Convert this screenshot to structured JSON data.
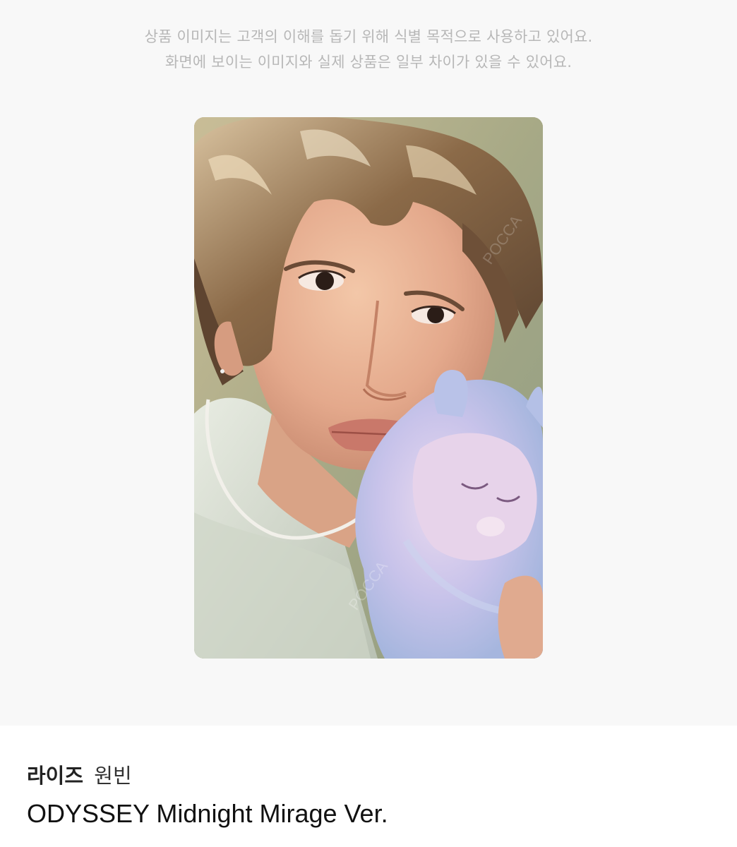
{
  "notice": {
    "line1": "상품 이미지는 고객의 이해를 돕기 위해 식별 목적으로 사용하고 있어요.",
    "line2": "화면에 보이는 이미지와 실제 상품은 일부 차이가 있을 수 있어요."
  },
  "product": {
    "artist": "라이즈",
    "member": "원빈",
    "version": "ODYSSEY Midnight Mirage Ver.",
    "image_subject": "photocard"
  }
}
